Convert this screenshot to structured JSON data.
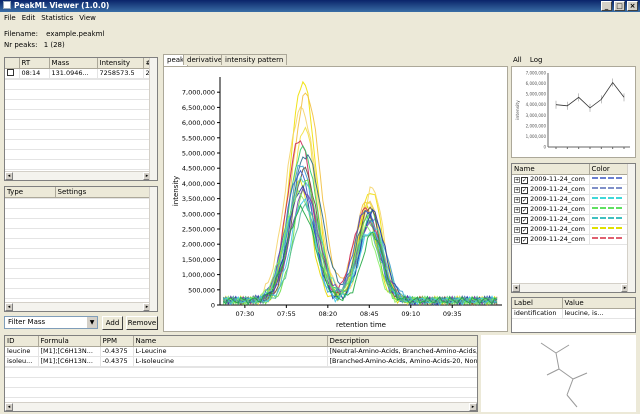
{
  "window": {
    "title": "PeakML Viewer (1.0.0)"
  },
  "menu": [
    "File",
    "Edit",
    "Statistics",
    "View"
  ],
  "info": {
    "filename_label": "Filename:",
    "filename": "example.peakml",
    "peaks_label": "Nr peaks:",
    "peaks": "1 (28)"
  },
  "peaks_table": {
    "headers": [
      "",
      "RT",
      "Mass",
      "Intensity",
      "#"
    ],
    "rows": [
      {
        "checked": false,
        "rt": "08:14",
        "mass": "131.0946...",
        "intensity": "7258573.5",
        "count": "28"
      }
    ]
  },
  "settings_table": {
    "headers": [
      "Type",
      "Settings"
    ]
  },
  "filter": {
    "value": "Filter Mass",
    "add": "Add",
    "remove": "Remove"
  },
  "tabs": [
    "peak",
    "derivatives",
    "intensity pattern"
  ],
  "chart_data": {
    "type": "line",
    "xlabel": "retention time",
    "ylabel": "intensity",
    "ylim": [
      0,
      7500000
    ],
    "y_ticks": [
      "0",
      "500,000",
      "1,000,000",
      "1,500,000",
      "2,000,000",
      "2,500,000",
      "3,000,000",
      "3,500,000",
      "4,000,000",
      "4,500,000",
      "5,000,000",
      "5,500,000",
      "6,000,000",
      "6,500,000",
      "7,000,000"
    ],
    "x_ticks": [
      "07:30",
      "07:55",
      "08:20",
      "08:45",
      "09:10",
      "09:35"
    ],
    "xlim": [
      450,
      620
    ],
    "peaks": [
      {
        "p1": 3900000,
        "p2": 3000000,
        "color": "#e6d800"
      },
      {
        "p1": 7200000,
        "p2": 3600000,
        "color": "#f0e000"
      },
      {
        "p1": 6800000,
        "p2": 3300000,
        "color": "#f2c040"
      },
      {
        "p1": 6300000,
        "p2": 3700000,
        "color": "#f5d46a"
      },
      {
        "p1": 5700000,
        "p2": 3200000,
        "color": "#f0e040"
      },
      {
        "p1": 5300000,
        "p2": 3000000,
        "color": "#cc2255"
      },
      {
        "p1": 5000000,
        "p2": 2900000,
        "color": "#33cc66"
      },
      {
        "p1": 4800000,
        "p2": 2800000,
        "color": "#2a6a8a"
      },
      {
        "p1": 4500000,
        "p2": 2700000,
        "color": "#3aa0d0"
      },
      {
        "p1": 4300000,
        "p2": 3100000,
        "color": "#6a4e3a"
      },
      {
        "p1": 4200000,
        "p2": 3000000,
        "color": "#3a5ac8"
      },
      {
        "p1": 4000000,
        "p2": 2600000,
        "color": "#50d0c0"
      },
      {
        "p1": 3900000,
        "p2": 2700000,
        "color": "#66dd44"
      },
      {
        "p1": 3700000,
        "p2": 2900000,
        "color": "#2233aa"
      },
      {
        "p1": 3600000,
        "p2": 2500000,
        "color": "#7744aa"
      },
      {
        "p1": 3500000,
        "p2": 2400000,
        "color": "#88ee66"
      },
      {
        "p1": 3300000,
        "p2": 2300000,
        "color": "#40c8e8"
      },
      {
        "p1": 3100000,
        "p2": 2200000,
        "color": "#55bb99"
      },
      {
        "p1": 3000000,
        "p2": 2200000,
        "color": "#22aa44"
      }
    ]
  },
  "right_tabs": [
    "All",
    "Log"
  ],
  "mini_chart": {
    "y_ticks": [
      "0",
      "1,000,000",
      "2,000,000",
      "3,000,000",
      "4,000,000",
      "5,000,000",
      "6,000,000",
      "7,000,000"
    ],
    "ylabel": "intensity",
    "values": [
      4000000,
      3900000,
      4700000,
      3700000,
      4500000,
      6100000,
      4700000
    ]
  },
  "sets_table": {
    "headers": [
      "Name",
      "Color"
    ],
    "rows": [
      {
        "name": "2009-11-24_com",
        "color": "#6a7fd0"
      },
      {
        "name": "2009-11-24_com",
        "color": "#8090c8"
      },
      {
        "name": "2009-11-24_com",
        "color": "#40d8d8"
      },
      {
        "name": "2009-11-24_com",
        "color": "#60e060"
      },
      {
        "name": "2009-11-24_com",
        "color": "#40c0c0"
      },
      {
        "name": "2009-11-24_com",
        "color": "#e0e000"
      },
      {
        "name": "2009-11-24_com",
        "color": "#e06070"
      }
    ]
  },
  "label_table": {
    "headers": [
      "Label",
      "Value"
    ],
    "rows": [
      {
        "label": "identification",
        "value": "leucine, is..."
      }
    ]
  },
  "ident_table": {
    "headers": [
      "ID",
      "Formula",
      "PPM",
      "Name",
      "Description"
    ],
    "rows": [
      {
        "id": "leucine",
        "formula": "[M1];[C6H13N...",
        "ppm": "-0.4375",
        "name": "L-Leucine",
        "desc": "[Neutral-Amino-Acids, Branched-Amino-Acids, Am"
      },
      {
        "id": "isoleu...",
        "formula": "[M1];[C6H13N...",
        "ppm": "-0.4375",
        "name": "L-Isoleucine",
        "desc": "[Branched-Amino-Acids, Amino-Acids-20, Non-po"
      }
    ]
  }
}
